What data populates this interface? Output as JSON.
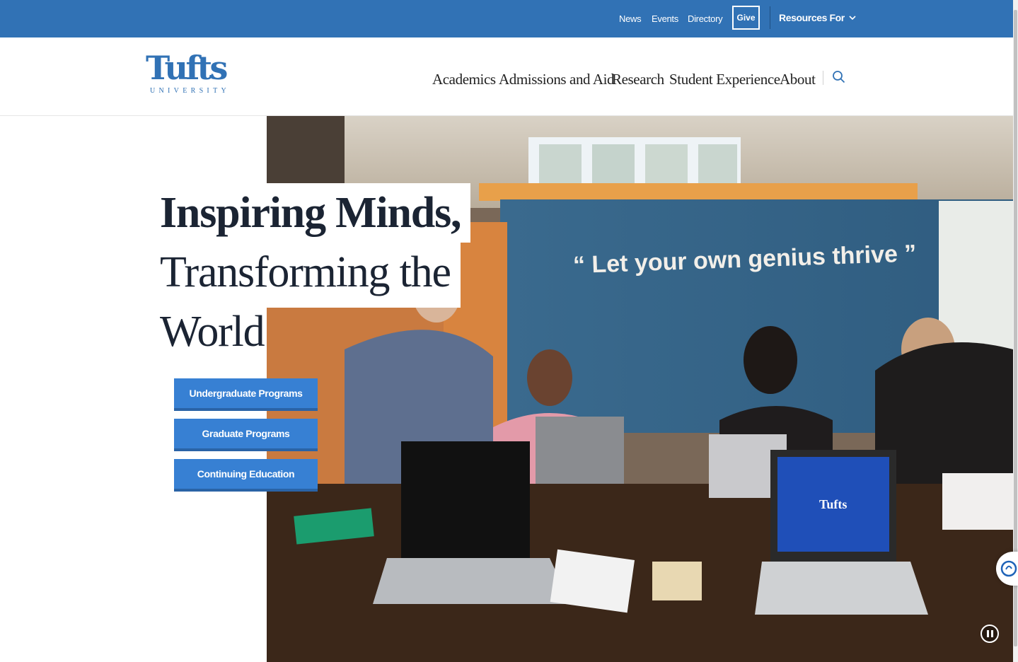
{
  "utility_nav": {
    "news": "News",
    "events": "Events",
    "directory": "Directory",
    "give": "Give",
    "resources": "Resources For"
  },
  "logo": {
    "wordmark": "Tufts",
    "subtitle": "UNIVERSITY"
  },
  "main_nav": {
    "items": [
      "Academics",
      "Admissions and Aid",
      "Research",
      "Student Experience",
      "About"
    ]
  },
  "hero": {
    "headline_lines": [
      "Inspiring Minds,",
      "Transforming the",
      "World"
    ],
    "wall_quote": "“ Let your own genius thrive ”",
    "laptop_label": "Tufts"
  },
  "cta_buttons": {
    "undergraduate": "Undergraduate Programs",
    "graduate": "Graduate Programs",
    "continuing": "Continuing Education"
  },
  "colors": {
    "brand_blue": "#3172b5",
    "button_blue": "#3780d3",
    "headline": "#1b2433"
  },
  "icons": {
    "search": "search-icon",
    "chevron": "chevron-down-icon",
    "pause": "pause-icon",
    "accessibility": "accessibility-icon"
  }
}
